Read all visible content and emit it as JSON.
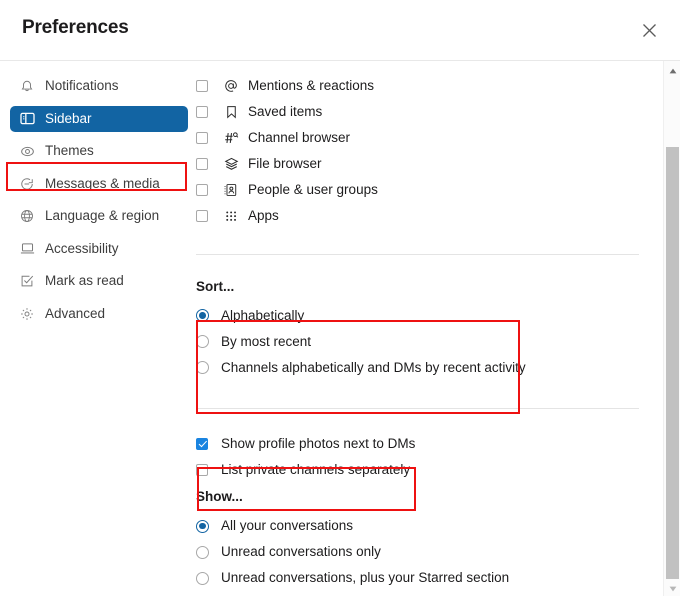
{
  "header": {
    "title": "Preferences",
    "close_label": "Close",
    "close_icon": "close-icon"
  },
  "sidebar": {
    "items": [
      {
        "label": "Notifications",
        "icon": "bell-icon",
        "selected": false
      },
      {
        "label": "Sidebar",
        "icon": "sidebar-panel-icon",
        "selected": true
      },
      {
        "label": "Themes",
        "icon": "eye-icon",
        "selected": false
      },
      {
        "label": "Messages & media",
        "icon": "message-bubble-icon",
        "selected": false
      },
      {
        "label": "Language & region",
        "icon": "globe-icon",
        "selected": false
      },
      {
        "label": "Accessibility",
        "icon": "monitor-icon",
        "selected": false
      },
      {
        "label": "Mark as read",
        "icon": "check-square-icon",
        "selected": false
      },
      {
        "label": "Advanced",
        "icon": "gear-icon",
        "selected": false
      }
    ]
  },
  "main": {
    "shortcut_items": [
      {
        "label": "Mentions & reactions",
        "icon": "at-mention-icon",
        "checked": false
      },
      {
        "label": "Saved items",
        "icon": "bookmark-icon",
        "checked": false
      },
      {
        "label": "Channel browser",
        "icon": "hash-search-icon",
        "checked": false
      },
      {
        "label": "File browser",
        "icon": "layers-icon",
        "checked": false
      },
      {
        "label": "People & user groups",
        "icon": "person-card-icon",
        "checked": false
      },
      {
        "label": "Apps",
        "icon": "grid-dots-icon",
        "checked": false
      }
    ],
    "sort": {
      "title": "Sort...",
      "options": [
        {
          "label": "Alphabetically",
          "selected": true
        },
        {
          "label": "By most recent",
          "selected": false
        },
        {
          "label": "Channels alphabetically and DMs by recent activity",
          "selected": false
        }
      ]
    },
    "display_options": [
      {
        "label": "Show profile photos next to DMs",
        "checked": true
      },
      {
        "label": "List private channels separately",
        "checked": false
      }
    ],
    "show": {
      "title": "Show...",
      "options": [
        {
          "label": "All your conversations",
          "selected": true
        },
        {
          "label": "Unread conversations only",
          "selected": false
        },
        {
          "label": "Unread conversations, plus your Starred section",
          "selected": false
        }
      ]
    }
  },
  "scrollbar": {
    "up_arrow_icon": "triangle-up-icon",
    "down_arrow_icon": "triangle-down-icon"
  },
  "colors": {
    "accent_blue": "#1264a3",
    "checkbox_blue": "#1a84e0",
    "highlight_red": "#ee1111"
  }
}
